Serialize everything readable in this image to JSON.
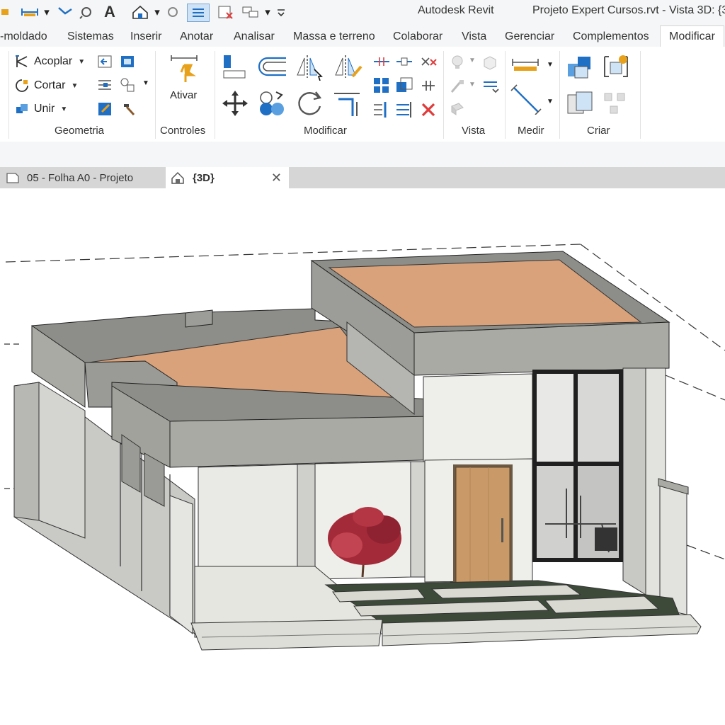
{
  "app": {
    "name": "Autodesk Revit",
    "document_title": "Projeto Expert Cursos.rvt - Vista 3D: {3"
  },
  "quick_access": {
    "icons": [
      "measure-icon",
      "dimension-icon",
      "tag-icon",
      "text-icon",
      "home-3d-icon",
      "section-icon",
      "thin-lines-icon",
      "close-hidden-icon",
      "switch-windows-icon",
      "customize-icon"
    ],
    "text_tool": "A"
  },
  "ribbon_tabs": [
    "-moldado",
    "Sistemas",
    "Inserir",
    "Anotar",
    "Analisar",
    "Massa e terreno",
    "Colaborar",
    "Vista",
    "Gerenciar",
    "Complementos",
    "Modificar"
  ],
  "active_tab": "Modificar",
  "panels": {
    "geometria": {
      "label": "Geometria",
      "buttons": [
        {
          "label": "Acoplar",
          "icon": "cope-icon"
        },
        {
          "label": "Cortar",
          "icon": "cut-icon"
        },
        {
          "label": "Unir",
          "icon": "join-icon"
        }
      ]
    },
    "controles": {
      "label": "Controles",
      "activate_label": "Ativar"
    },
    "modificar": {
      "label": "Modificar"
    },
    "vista": {
      "label": "Vista"
    },
    "medir": {
      "label": "Medir"
    },
    "criar": {
      "label": "Criar"
    }
  },
  "view_tabs": [
    {
      "label": "05 - Folha A0 - Projeto",
      "icon": "sheet-icon",
      "active": false
    },
    {
      "label": "{3D}",
      "icon": "house-icon",
      "active": true
    }
  ],
  "colors": {
    "accent_blue": "#1f6fc4",
    "roof_fill": "#d9a27a",
    "parapet_gray": "#a9aaa4",
    "wall_white": "#eeeeea",
    "door_wood": "#c99a68",
    "tree_red": "#a32a38",
    "delete_red": "#e03b3b"
  }
}
